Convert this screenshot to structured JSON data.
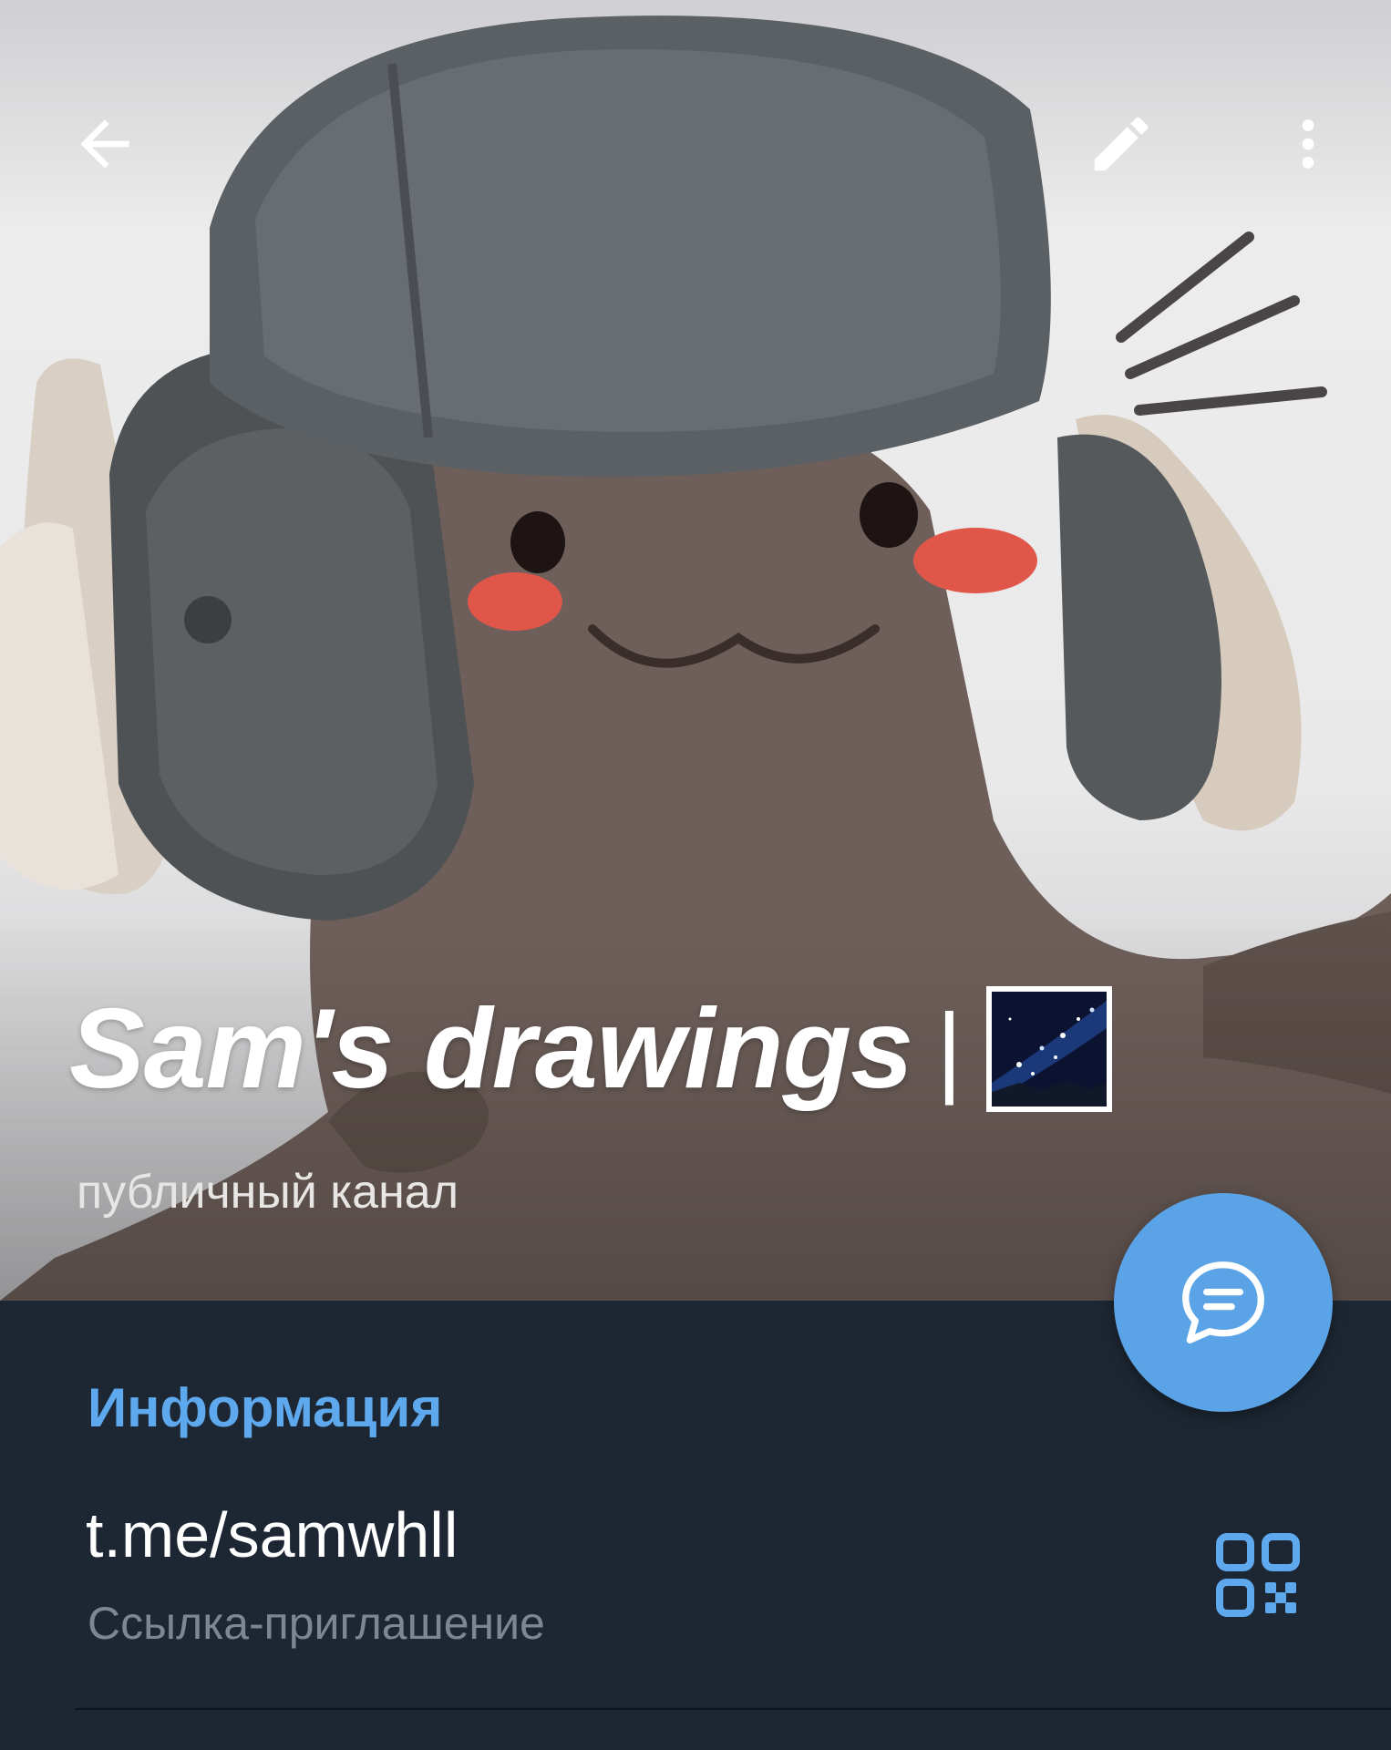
{
  "header": {
    "title": "Sam's drawings",
    "title_separator": "|",
    "title_emoji": "milky-way-emoji",
    "subtitle": "публичный канал"
  },
  "toolbar": {
    "back_icon": "arrow-left-icon",
    "edit_icon": "pencil-icon",
    "more_icon": "more-vertical-icon"
  },
  "fab": {
    "icon": "chat-bubble-icon",
    "color": "#5aa3e6"
  },
  "info": {
    "heading": "Информация",
    "link": "t.me/samwhll",
    "link_caption": "Ссылка-приглашение",
    "qr_icon": "qr-code-icon"
  },
  "colors": {
    "background": "#1d2733",
    "accent": "#5ea8ee",
    "caption": "#7d8794"
  }
}
